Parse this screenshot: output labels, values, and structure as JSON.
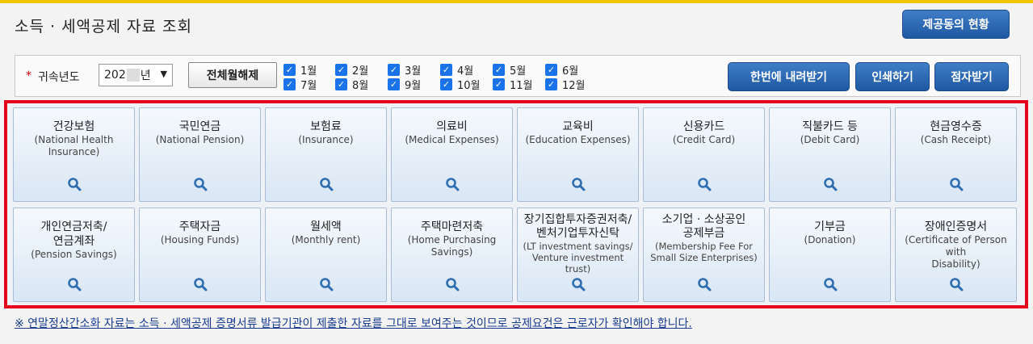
{
  "header": {
    "title": "소득 · 세액공제 자료 조회",
    "status_button": "제공동의 현황"
  },
  "filter": {
    "required_mark": "*",
    "year_label": "귀속년도",
    "year_value_prefix": "202",
    "year_value_suffix": "년",
    "deselect_all": "전체월해제",
    "months": [
      "1월",
      "2월",
      "3월",
      "4월",
      "5월",
      "6월",
      "7월",
      "8월",
      "9월",
      "10월",
      "11월",
      "12월"
    ],
    "months_checked": [
      true,
      true,
      true,
      true,
      true,
      true,
      true,
      true,
      true,
      true,
      true,
      true
    ],
    "actions": {
      "download_all": "한번에 내려받기",
      "print": "인쇄하기",
      "braille": "점자받기"
    }
  },
  "categories": [
    {
      "ko": "건강보험",
      "en": "(National Health\nInsurance)"
    },
    {
      "ko": "국민연금",
      "en": "(National Pension)"
    },
    {
      "ko": "보험료",
      "en": "(Insurance)"
    },
    {
      "ko": "의료비",
      "en": "(Medical Expenses)"
    },
    {
      "ko": "교육비",
      "en": "(Education Expenses)"
    },
    {
      "ko": "신용카드",
      "en": "(Credit Card)"
    },
    {
      "ko": "직불카드 등",
      "en": "(Debit Card)"
    },
    {
      "ko": "현금영수증",
      "en": "(Cash Receipt)"
    },
    {
      "ko": "개인연금저축/\n연금계좌",
      "en": "(Pension Savings)"
    },
    {
      "ko": "주택자금",
      "en": "(Housing Funds)"
    },
    {
      "ko": "월세액",
      "en": "(Monthly rent)"
    },
    {
      "ko": "주택마련저축",
      "en": "(Home Purchasing\nSavings)"
    },
    {
      "ko": "장기집합투자증권저축/\n벤처기업투자신탁",
      "en": "(LT investment savings/\nVenture investment\ntrust)"
    },
    {
      "ko": "소기업 · 소상공인\n공제부금",
      "en": "(Membership Fee For\nSmall Size Enterprises)"
    },
    {
      "ko": "기부금",
      "en": "(Donation)"
    },
    {
      "ko": "장애인증명서",
      "en": "(Certificate of Person with\nDisability)"
    }
  ],
  "notice": "※ 연말정산간소화 자료는 소득 · 세액공제 증명서류 발급기관이 제출한 자료를 그대로 보여주는 것이므로 공제요건은 근로자가 확인해야 합니다.",
  "colors": {
    "accent_blue": "#1f58a3",
    "highlight_red": "#e5001b",
    "checkbox_blue": "#1a73e8"
  },
  "icons": {
    "tile_icon": "magnifier-icon",
    "select_chevron": "chevron-down-icon"
  }
}
